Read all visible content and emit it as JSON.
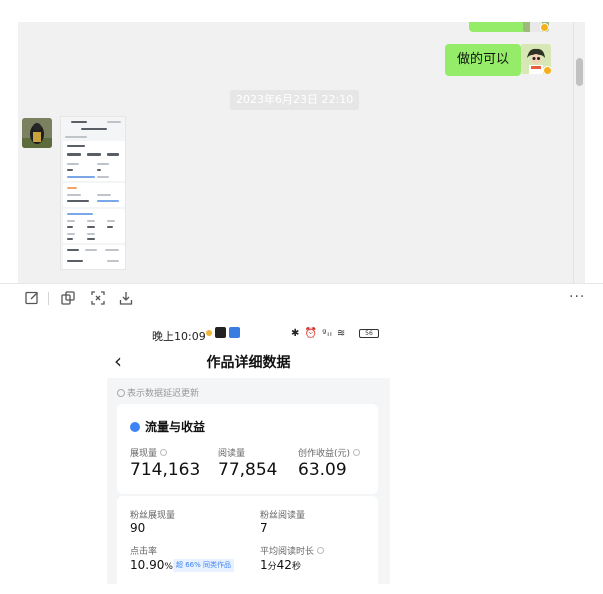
{
  "chat": {
    "messages": [
      {
        "type": "text",
        "side": "right",
        "text": "做的可以"
      }
    ],
    "timestamp": "2023年6月23日 22:10"
  },
  "toolbar": {
    "tools": [
      "edit-icon",
      "screenshot-icon",
      "scan-icon",
      "download-icon"
    ],
    "more": "···"
  },
  "phone": {
    "status": {
      "time": "晚上10:09",
      "right": "✱ ⏰ ᵍᵢₗ ≋",
      "battery": "56"
    },
    "nav": {
      "back": "‹",
      "title": "作品详细数据"
    },
    "delay_note": "表示数据延迟更新",
    "section1": {
      "title": "流量与收益",
      "metrics": [
        {
          "label": "展现量",
          "value": "714,163"
        },
        {
          "label": "阅读量",
          "value": "77,854"
        },
        {
          "label": "创作收益(元)",
          "value": "63.09"
        }
      ]
    },
    "section2": {
      "metrics": [
        {
          "label": "粉丝展现量",
          "value": "90"
        },
        {
          "label": "粉丝阅读量",
          "value": "7"
        }
      ],
      "ctr": {
        "label": "点击率",
        "value": "10.90",
        "unit": "%",
        "tag": "超 66% 同类作品"
      },
      "avg_read": {
        "label": "平均阅读时长",
        "min": "1",
        "min_unit": "分",
        "sec": "42",
        "sec_unit": "秒"
      }
    }
  },
  "colors": {
    "chat_bg": "#f1f1f1",
    "bubble_green": "#95ec69",
    "accent_blue": "#3d83f6"
  }
}
